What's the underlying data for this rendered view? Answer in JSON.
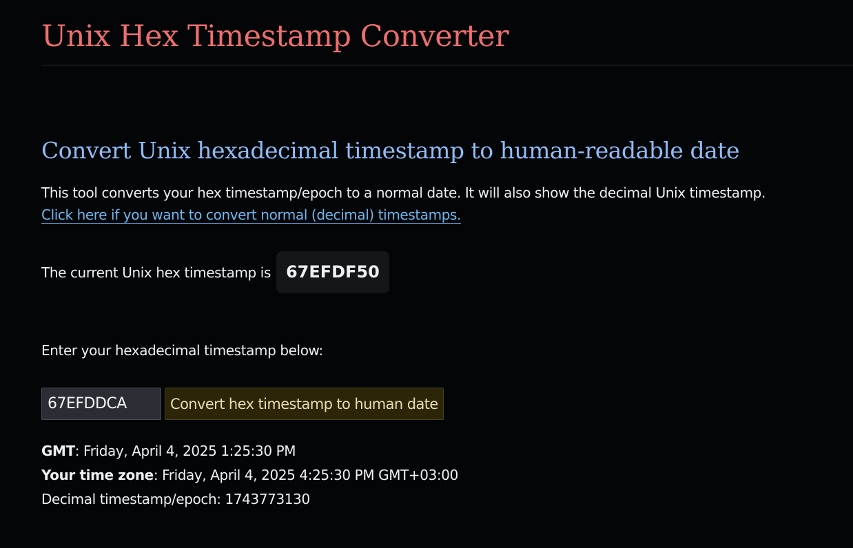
{
  "header": {
    "title": "Unix Hex Timestamp Converter"
  },
  "main": {
    "heading": "Convert Unix hexadecimal timestamp to human-readable date",
    "intro_text": "This tool converts your hex timestamp/epoch to a normal date. It will also show the decimal Unix timestamp.",
    "intro_link": "Click here if you want to convert normal (decimal) timestamps.",
    "current_label": "The current Unix hex timestamp is",
    "current_value": "67EFDF50",
    "enter_label": "Enter your hexadecimal timestamp below:",
    "input_value": "67EFDDCA",
    "convert_button": "Convert hex timestamp to human date"
  },
  "result": {
    "gmt_label": "GMT",
    "gmt_value": ": Friday, April 4, 2025 1:25:30 PM",
    "tz_label": "Your time zone",
    "tz_value": ": Friday, April 4, 2025 4:25:30 PM GMT+03:00",
    "decimal_text": "Decimal timestamp/epoch: 1743773130"
  },
  "colors": {
    "background": "#030507",
    "title": "#ee6e6e",
    "heading": "#8ebcf5",
    "link": "#6fb8f0",
    "button_bg": "#2c2508"
  }
}
